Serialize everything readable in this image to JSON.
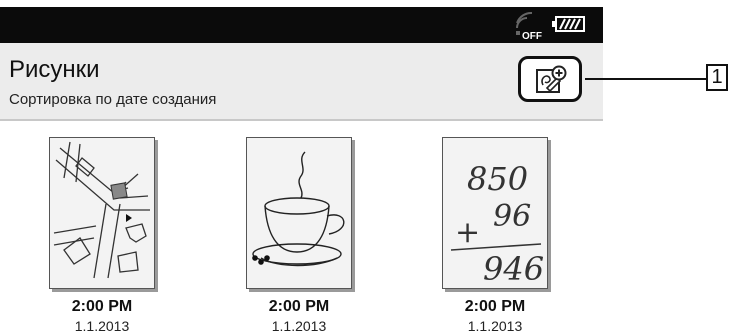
{
  "status_bar": {
    "wifi_icon": "wifi-off-icon",
    "wifi_label": "OFF",
    "battery_icon": "battery-icon"
  },
  "header": {
    "title": "Рисунки",
    "subtitle": "Сортировка по дате создания",
    "new_drawing_icon": "new-drawing-icon"
  },
  "callout": {
    "label": "1"
  },
  "drawings": [
    {
      "time": "2:00 PM",
      "date": "1.1.2013",
      "thumbnail": "map-sketch"
    },
    {
      "time": "2:00 PM",
      "date": "1.1.2013",
      "thumbnail": "coffee-cup-sketch"
    },
    {
      "time": "2:00 PM",
      "date": "1.1.2013",
      "thumbnail": "addition-sketch"
    }
  ],
  "handwriting": {
    "line1": "850",
    "line2": "96",
    "plus": "+",
    "result": "946"
  }
}
